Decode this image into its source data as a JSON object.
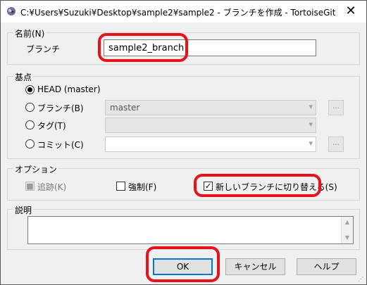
{
  "window": {
    "title": "C:¥Users¥Suzuki¥Desktop¥sample2¥sample2 - ブランチを作成 - TortoiseGit",
    "close_glyph": "✕"
  },
  "name_group": {
    "legend": "名前(N)",
    "branch_label": "ブランチ",
    "branch_value": "sample2_branch"
  },
  "base_group": {
    "legend": "基点",
    "head_label": "HEAD (master)",
    "branch_label": "ブランチ(B)",
    "branch_value": "master",
    "tag_label": "タグ(T)",
    "tag_value": "",
    "commit_label": "コミット(C)",
    "commit_value": "",
    "browse_label": "..."
  },
  "options_group": {
    "legend": "オプション",
    "track_label": "追跡(K)",
    "force_label": "強制(F)",
    "switch_label": "新しいブランチに切り替える(S)"
  },
  "desc_group": {
    "legend": "説明",
    "value": ""
  },
  "buttons": {
    "ok": "OK",
    "cancel": "キャンセル",
    "help": "ヘルプ"
  },
  "icons": {
    "app": "tortoisegit-icon",
    "dropdown": "▾",
    "scroll_up": "▲",
    "scroll_down": "▼"
  }
}
